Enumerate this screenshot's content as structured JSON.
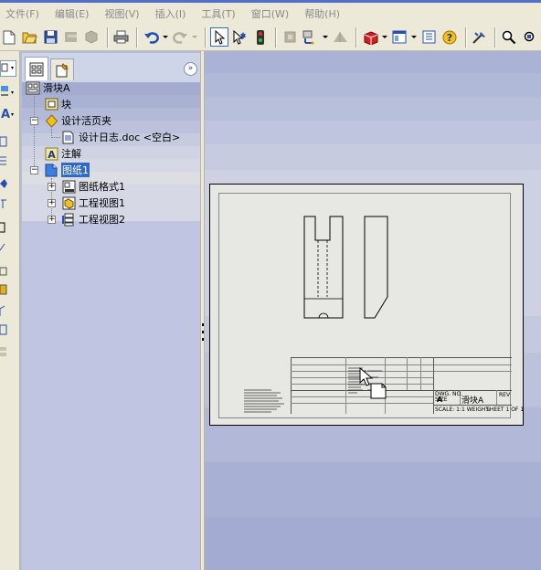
{
  "menu": {
    "items": [
      "文件(F)",
      "编辑(E)",
      "视图(V)",
      "插入(I)",
      "工具(T)",
      "窗口(W)",
      "帮助(H)"
    ]
  },
  "toolbar": {
    "buttons": [
      "new-icon",
      "open-icon",
      "save-icon",
      "grey-icon",
      "grey-icon",
      "print-icon",
      "undo-icon",
      "redo-icon",
      "select-icon",
      "smart-select-icon",
      "traffic-light-icon",
      "grey-icon",
      "dropdown-icon",
      "grey-icon",
      "cube-icon",
      "view-icon",
      "properties-icon",
      "help-icon",
      "tool-icon",
      "zoom-icon",
      "zoom-fit-icon"
    ]
  },
  "featureManager": {
    "tabs": [
      "feature-tree-tab",
      "property-tab"
    ],
    "root": {
      "label": "滑块A"
    },
    "nodes": [
      {
        "label": "块",
        "icon": "block-icon"
      },
      {
        "label": "设计活页夹",
        "icon": "binder-icon"
      },
      {
        "label": "设计日志.doc <空白>",
        "icon": "document-icon"
      },
      {
        "label": "注解",
        "icon": "annotation-icon"
      },
      {
        "label": "图纸1",
        "icon": "sheet-icon",
        "selected": true
      },
      {
        "label": "图纸格式1",
        "icon": "sheet-format-icon"
      },
      {
        "label": "工程视图1",
        "icon": "drawing-view-icon"
      },
      {
        "label": "工程视图2",
        "icon": "drawing-view2-icon"
      }
    ]
  },
  "drawing": {
    "titleBlock": {
      "partName": "滑块A",
      "dwgLabel": "DWG. NO.",
      "sizeLabel": "SIZE",
      "sizeValue": "A",
      "revLabel": "REV",
      "scaleLabel": "SCALE: 1:1 WEIGHT:",
      "sheetLabel": "SHEET 1 OF 1"
    }
  },
  "colors": {
    "accent": "#316ac5",
    "background": "#b4bcd8"
  }
}
